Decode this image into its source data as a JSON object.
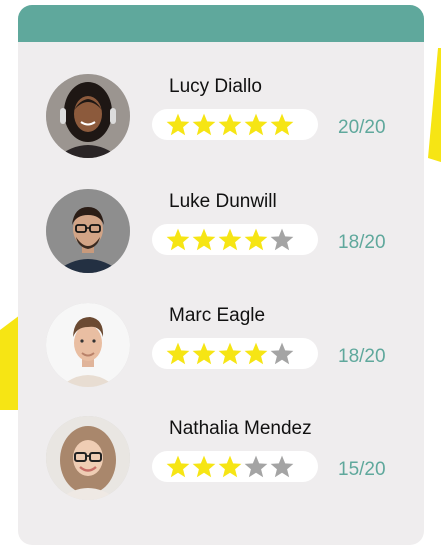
{
  "colors": {
    "header": "#5fa89c",
    "card": "#efedee",
    "accent": "#f6e514",
    "star_on": "#f6e514",
    "star_off": "#a4a4a4",
    "score": "#5fa89c"
  },
  "reviewers": [
    {
      "name": "Lucy Diallo",
      "rating": 5,
      "max_rating": 5,
      "score": "20/20"
    },
    {
      "name": "Luke Dunwill",
      "rating": 4,
      "max_rating": 5,
      "score": "18/20"
    },
    {
      "name": "Marc Eagle",
      "rating": 4,
      "max_rating": 5,
      "score": "18/20"
    },
    {
      "name": "Nathalia Mendez",
      "rating": 3,
      "max_rating": 5,
      "score": "15/20"
    }
  ]
}
